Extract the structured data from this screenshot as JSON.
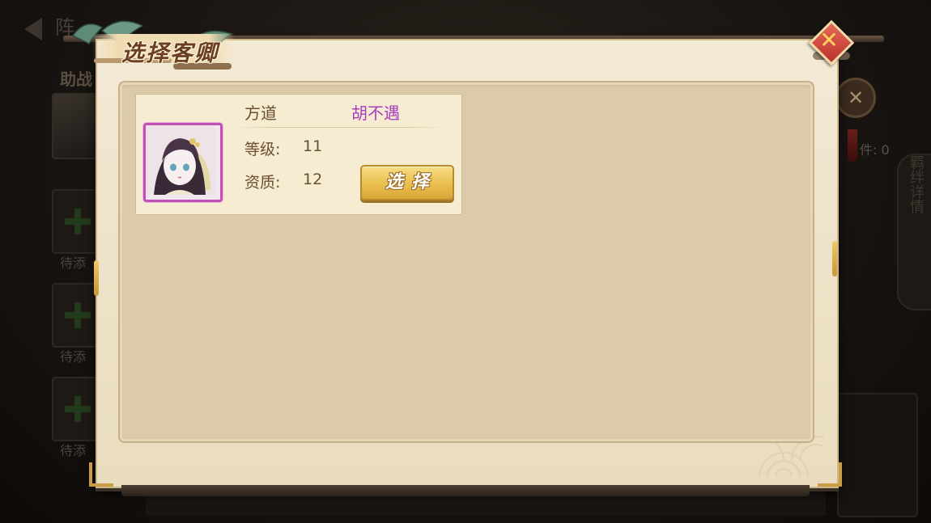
{
  "background": {
    "screen_title": "阵",
    "side_label": "助战",
    "empty_slot_label": "待添",
    "right_panel_label": "羁绊详情",
    "count_text": "件: 0",
    "medallion_icon": "close-icon"
  },
  "dialog": {
    "title": "选择客卿",
    "close_icon": "close-icon"
  },
  "character": {
    "faction": "方道",
    "name": "胡不遇",
    "level_label": "等级:",
    "level_value": "11",
    "aptitude_label": "资质:",
    "aptitude_value": "12",
    "select_label": "选择",
    "frame_color": "#c24fb5",
    "name_color": "#a83ec0"
  }
}
